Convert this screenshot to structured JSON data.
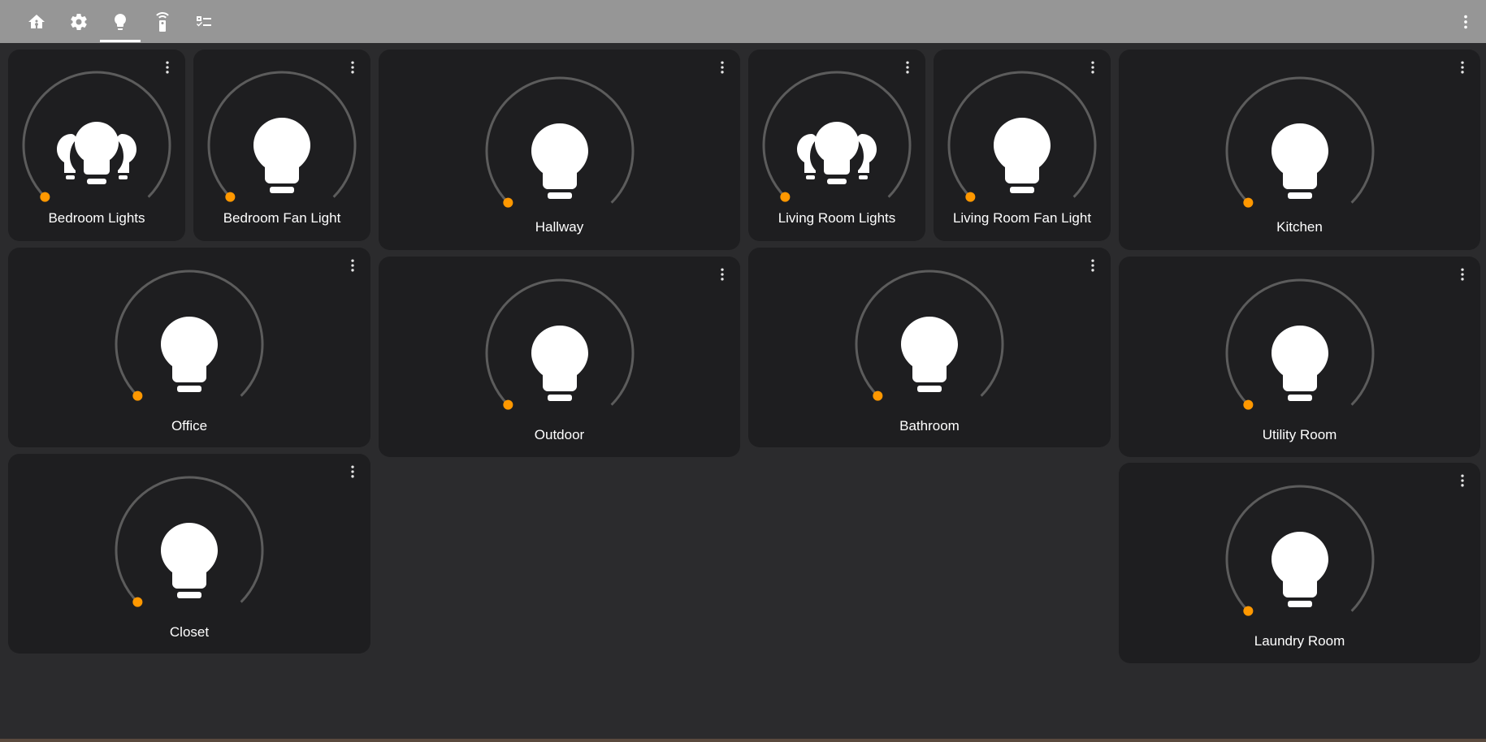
{
  "tabs": [
    {
      "name": "home-assistant-icon",
      "label": ""
    },
    {
      "name": "gear-icon",
      "label": ""
    },
    {
      "name": "lightbulb-icon",
      "label": "",
      "active": true
    },
    {
      "name": "remote-icon",
      "label": ""
    },
    {
      "name": "checklist-icon",
      "label": ""
    }
  ],
  "overflow_icon": "dots-vertical-icon",
  "accent_color": "#ff9800",
  "cards": [
    {
      "id": "bedroom-lights",
      "label": "Bedroom Lights",
      "icon": "lightbulb-group-icon"
    },
    {
      "id": "bedroom-fan-light",
      "label": "Bedroom Fan Light",
      "icon": "lightbulb-icon"
    },
    {
      "id": "hallway",
      "label": "Hallway",
      "icon": "lightbulb-icon"
    },
    {
      "id": "living-room-lights",
      "label": "Living Room Lights",
      "icon": "lightbulb-group-icon"
    },
    {
      "id": "living-room-fan-light",
      "label": "Living Room Fan Light",
      "icon": "lightbulb-icon"
    },
    {
      "id": "kitchen",
      "label": "Kitchen",
      "icon": "lightbulb-icon"
    },
    {
      "id": "office",
      "label": "Office",
      "icon": "lightbulb-icon"
    },
    {
      "id": "outdoor",
      "label": "Outdoor",
      "icon": "lightbulb-icon"
    },
    {
      "id": "bathroom",
      "label": "Bathroom",
      "icon": "lightbulb-icon"
    },
    {
      "id": "utility-room",
      "label": "Utility Room",
      "icon": "lightbulb-icon"
    },
    {
      "id": "closet",
      "label": "Closet",
      "icon": "lightbulb-icon"
    },
    {
      "id": "laundry-room",
      "label": "Laundry Room",
      "icon": "lightbulb-icon"
    }
  ]
}
